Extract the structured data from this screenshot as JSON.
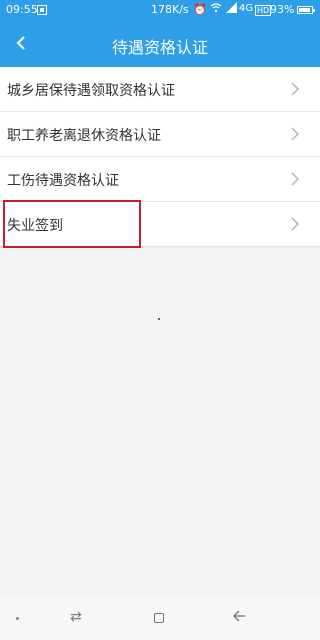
{
  "status_bar": {
    "time": "09:55",
    "speed": "178K/s",
    "network": "4G",
    "hd_badge": "HD",
    "battery": "93%",
    "battery_level": 0.93
  },
  "header": {
    "title": "待遇资格认证",
    "back_icon": "chevron-left-icon"
  },
  "list": {
    "items": [
      {
        "label": "城乡居保待遇领取资格认证"
      },
      {
        "label": "职工养老离退休资格认证"
      },
      {
        "label": "工伤待遇资格认证"
      },
      {
        "label": "失业签到"
      }
    ]
  },
  "colors": {
    "header_bg": "#2e9ee8",
    "highlight": "#c81e2b"
  },
  "system_nav": {
    "icons": [
      "dot-icon",
      "switch-icon",
      "square-icon",
      "back-arrow-icon"
    ]
  }
}
